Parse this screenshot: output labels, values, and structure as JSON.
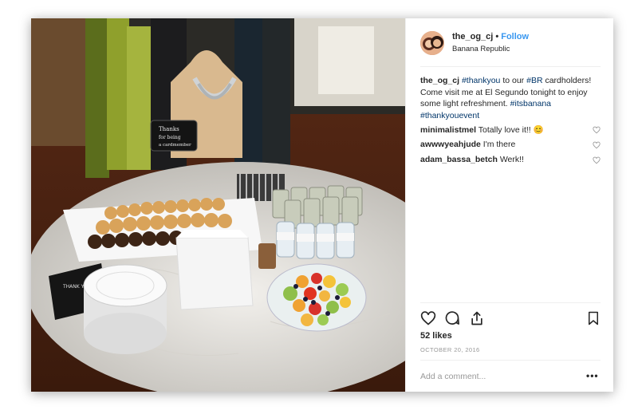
{
  "post": {
    "username": "the_og_cj",
    "separator": "•",
    "follow_label": "Follow",
    "location": "Banana Republic",
    "caption": {
      "author": "the_og_cj",
      "hashtag_thankyou": "#thankyou",
      "text_part1": "to our",
      "hashtag_br": "#BR",
      "text_part2": "cardholders! Come visit me at El Segundo tonight to enjoy some light refreshment.",
      "hashtag_itsbanana": "#itsbanana",
      "hashtag_thankyouevent": "#thankyouevent"
    },
    "comments": [
      {
        "user": "minimalistmel",
        "text": "Totally love it!!",
        "emoji": "😊"
      },
      {
        "user": "awwwyeahjude",
        "text": "I'm there"
      },
      {
        "user": "adam_bassa_betch",
        "text": "Werk!!"
      }
    ],
    "likes": "52 likes",
    "date": "OCTOBER 20, 2016",
    "add_comment_placeholder": "Add a comment...",
    "more_label": "•••"
  },
  "photo": {
    "sign_text": [
      "Thanks",
      "for being",
      "a cardmember"
    ],
    "card_text": "THANK YOU"
  },
  "icons": {
    "heart": "heart-icon",
    "comment": "comment-icon",
    "share": "share-icon",
    "bookmark": "bookmark-icon",
    "more": "more-options-icon"
  },
  "colors": {
    "follow": "#3897f0",
    "hashtag": "#003569",
    "text": "#262626",
    "muted": "#999999"
  }
}
